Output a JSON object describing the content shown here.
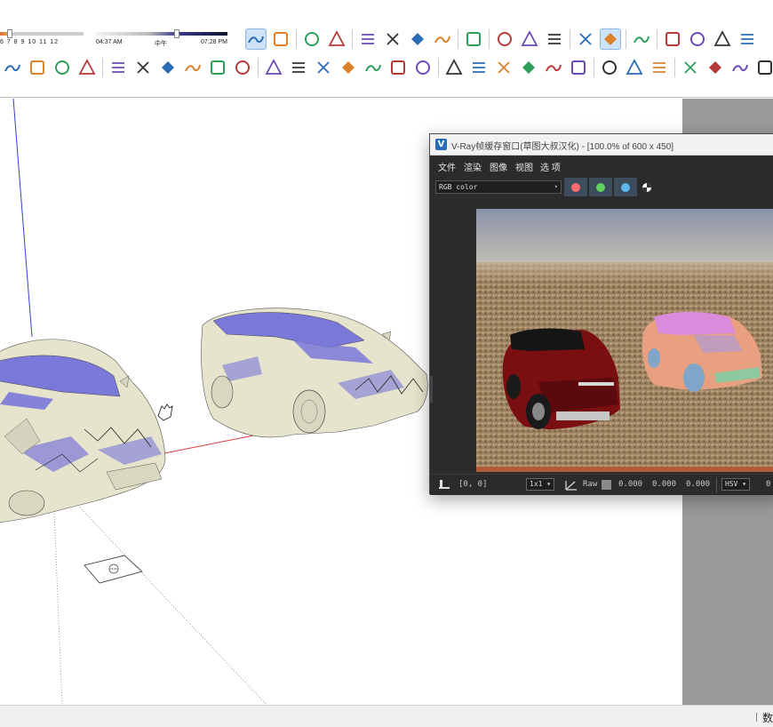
{
  "toolbar": {
    "shadow_months": "6 7 8 9 10 11 12",
    "shadow_time_start": "04:37 AM",
    "shadow_time_mid": "中午",
    "shadow_time_end": "07:28 PM",
    "row1_icons": [
      "sandbox-from-contours-icon",
      "sandbox-from-scratch-icon",
      "smoove-icon",
      "stamp-icon",
      "drape-icon",
      "add-detail-icon",
      "flip-edge-icon",
      "add-location-icon",
      "extension-warehouse-icon",
      "orbit-icon",
      "pan-icon",
      "zoom-extents-icon",
      "vray-render-icon",
      "vray-asset-editor-icon",
      "vray-light-icon",
      "vray-sun-icon",
      "vray-line-icon",
      "vray-box-icon",
      "vray-hide-icon"
    ],
    "row2_icons": [
      "section-plane-icon",
      "section-cut-icon",
      "section-fill-icon",
      "solid-tools-icon",
      "outer-shell-icon",
      "intersect-icon",
      "union-icon",
      "subtract-icon",
      "trim-icon",
      "split-icon",
      "style-xray-icon",
      "style-backedges-icon",
      "style-wireframe-icon",
      "style-hiddenline-icon",
      "style-shaded-icon",
      "style-textured-icon",
      "style-monochrome-icon",
      "camera-iso-icon",
      "camera-top-icon",
      "camera-front-icon",
      "camera-right-icon",
      "camera-back-icon",
      "camera-left-icon",
      "paint-bucket-icon",
      "refresh-icon",
      "layers-icon",
      "add-icon",
      "tree-icon",
      "terrain-icon",
      "checker-icon",
      "upload-icon"
    ]
  },
  "viewport": {
    "background": "#ffffff",
    "axis_blue": "#3b3bd6",
    "axis_red": "#d43a3a",
    "mesh_color": "#e6e4cc",
    "mesh_back_color": "#7a78d8"
  },
  "vray": {
    "title": "V-Ray帧缓存窗口(草图大叔汉化) - [100.0% of 600 x 450]",
    "menu": [
      "文件",
      "渲染",
      "图像",
      "视图",
      "选 项"
    ],
    "channel": "RGB color",
    "channel_colors": [
      "#ff6a6a",
      "#5fd35f",
      "#5fb6f0"
    ],
    "status": {
      "coords": "[0, 0]",
      "sampling": "1x1",
      "raw_label": "Raw",
      "raw_values": [
        "0.000",
        "0.000",
        "0.000"
      ],
      "color_space": "HSV",
      "trailing": "0"
    }
  },
  "status_bar": {
    "right_text": "数"
  },
  "colors": {
    "toolbar_active_bg": "#cfe3f7",
    "right_panel_bg": "#9a9a9a",
    "vray_bg": "#2b2b2b",
    "car1_color": "#7a0f12",
    "car2_color": "#e8a080"
  }
}
